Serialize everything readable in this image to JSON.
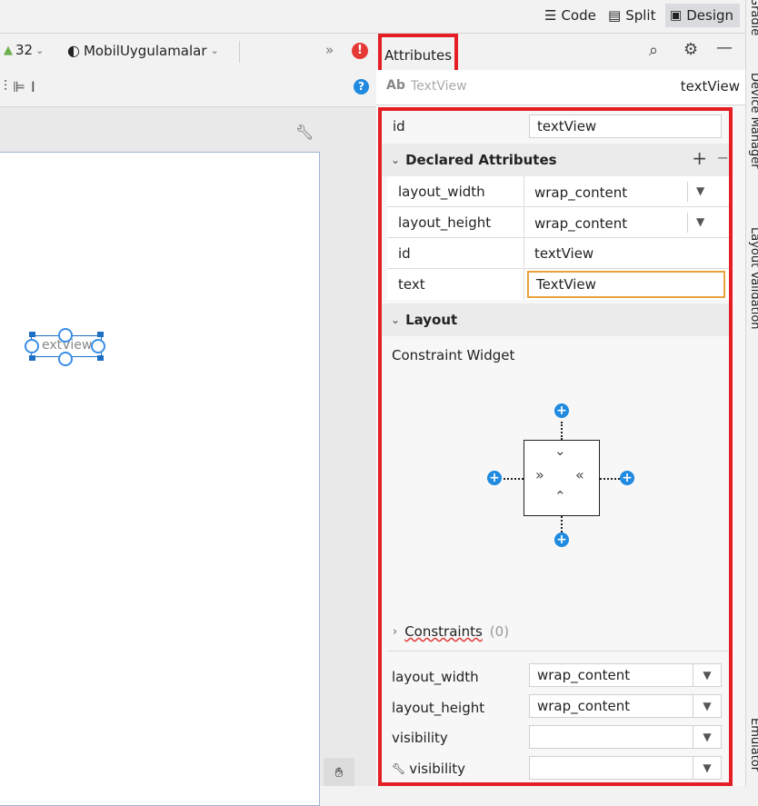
{
  "view_modes": {
    "code": "Code",
    "split": "Split",
    "design": "Design"
  },
  "toolbar": {
    "api_level": "32",
    "theme": "MobilUygulamalar",
    "overflow": "»"
  },
  "attributes_panel": {
    "title": "Attributes",
    "component_icon_label": "Ab",
    "component_type": "TextView",
    "component_id": "textView"
  },
  "id_row": {
    "label": "id",
    "value": "textView"
  },
  "declared_attributes": {
    "title": "Declared Attributes",
    "add": "+",
    "remove": "−",
    "rows": [
      {
        "label": "layout_width",
        "value": "wrap_content"
      },
      {
        "label": "layout_height",
        "value": "wrap_content"
      },
      {
        "label": "id",
        "value": "textView"
      },
      {
        "label": "text",
        "value": "TextView"
      }
    ]
  },
  "layout_section": {
    "title": "Layout",
    "widget_title": "Constraint Widget",
    "constraints_label": "Constraints",
    "constraints_count": "(0)",
    "rows": [
      {
        "label": "layout_width",
        "value": "wrap_content"
      },
      {
        "label": "layout_height",
        "value": "wrap_content"
      },
      {
        "label": "visibility",
        "value": ""
      },
      {
        "label": "visibility",
        "value": ""
      }
    ]
  },
  "canvas": {
    "widget_text": "extView"
  },
  "side_tabs": [
    "Gradle",
    "Device Manager",
    "Layout Validation",
    "Emulator"
  ],
  "colors": {
    "accent_blue": "#1f8ae0",
    "highlight_red": "#e51e25",
    "focus_orange": "#e8a33c",
    "error_red": "#e53935"
  }
}
